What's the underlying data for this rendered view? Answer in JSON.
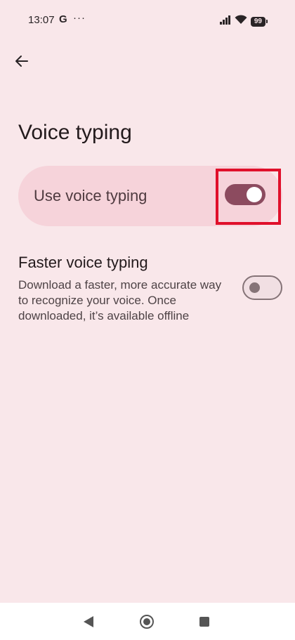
{
  "status_bar": {
    "time": "13:07",
    "g_label": "G",
    "dots": "···",
    "battery": "99"
  },
  "header": {
    "title": "Voice typing"
  },
  "main_toggle": {
    "label": "Use voice typing",
    "state": "on"
  },
  "faster_voice": {
    "title": "Faster voice typing",
    "description": "Download a faster, more accurate way to recognize your voice. Once downloaded, it’s available offline",
    "state": "off"
  },
  "colors": {
    "background": "#f9e7ea",
    "card": "#f6d3da",
    "switch_on": "#8c4b5f",
    "highlight": "#e0102b"
  }
}
